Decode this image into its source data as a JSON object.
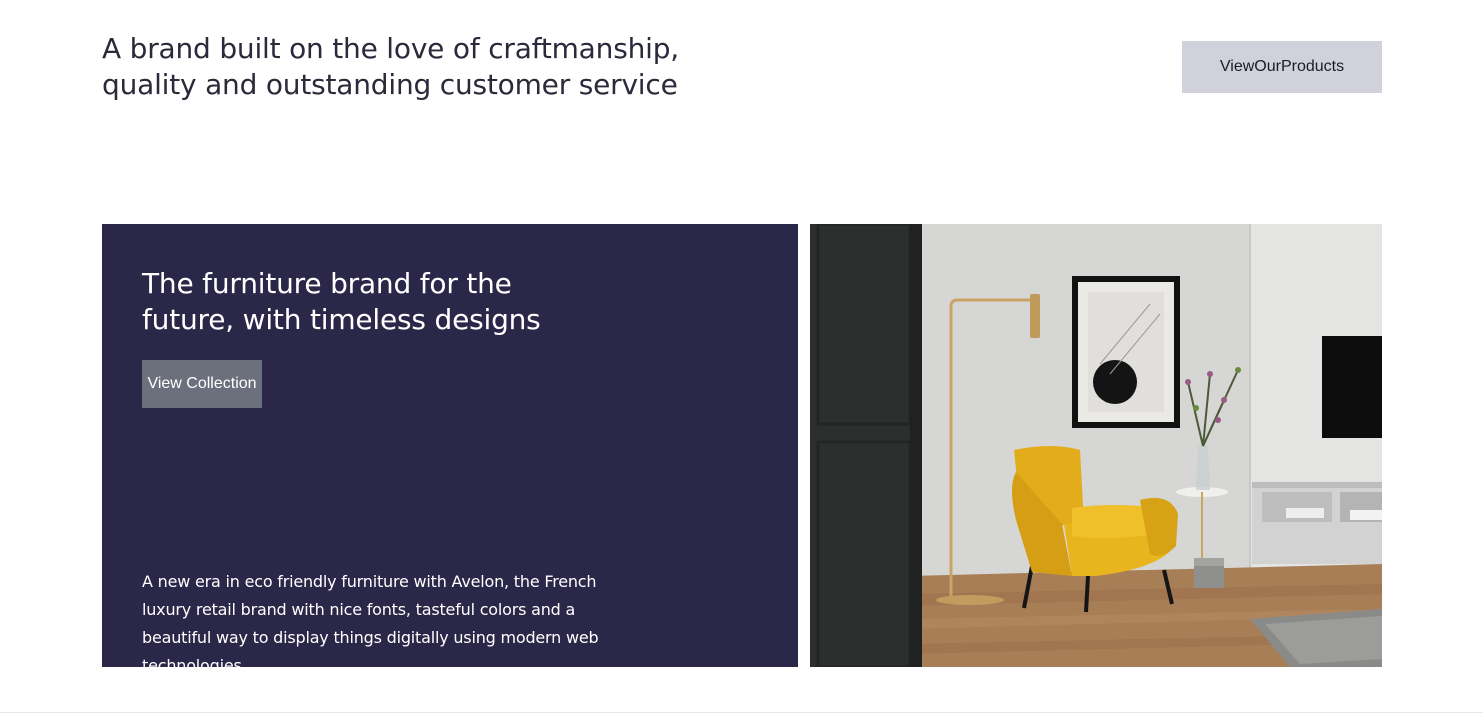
{
  "header": {
    "tagline": "A brand built on the love of craftmanship, quality and outstanding customer service",
    "products_button_label": "ViewOurProducts"
  },
  "feature": {
    "title": "The furniture brand for the future, with timeless designs",
    "collection_button_label": "View Collection",
    "description": "A new era in eco friendly furniture with Avelon, the French luxury retail brand with nice fonts, tasteful colors and a beautiful way to display things digitally using modern web technologies."
  },
  "colors": {
    "panel_background": "#2b2748",
    "products_button": "#d0d1db",
    "collection_button": "#6c707d",
    "chair_accent": "#e8b51f"
  }
}
